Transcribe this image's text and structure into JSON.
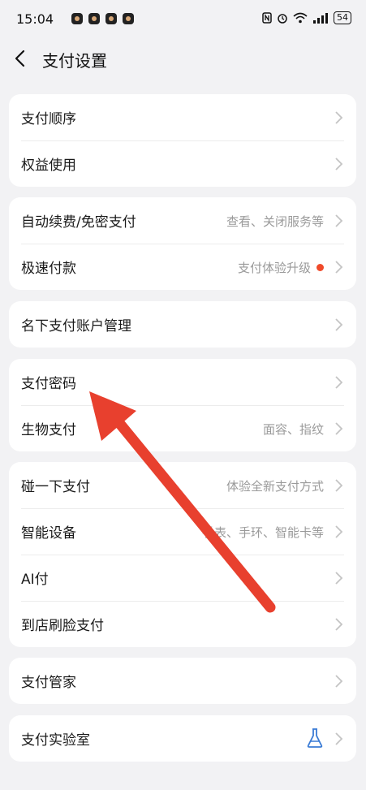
{
  "status_bar": {
    "time": "15:04",
    "signal": "all",
    "battery": "54"
  },
  "header": {
    "title": "支付设置",
    "back_icon": "chevron-left-icon"
  },
  "groups": [
    {
      "items": [
        {
          "label": "支付顺序",
          "hint": ""
        },
        {
          "label": "权益使用",
          "hint": ""
        }
      ]
    },
    {
      "items": [
        {
          "label": "自动续费/免密支付",
          "hint": "查看、关闭服务等"
        },
        {
          "label": "极速付款",
          "hint": "支付体验升级",
          "badge": "red-dot"
        }
      ]
    },
    {
      "items": [
        {
          "label": "名下支付账户管理",
          "hint": ""
        }
      ]
    },
    {
      "items": [
        {
          "label": "支付密码",
          "hint": ""
        },
        {
          "label": "生物支付",
          "hint": "面容、指纹"
        }
      ]
    },
    {
      "items": [
        {
          "label": "碰一下支付",
          "hint": "体验全新支付方式"
        },
        {
          "label": "智能设备",
          "hint": "手表、手环、智能卡等"
        },
        {
          "label": "AI付",
          "hint": ""
        },
        {
          "label": "到店刷脸支付",
          "hint": ""
        }
      ]
    },
    {
      "items": [
        {
          "label": "支付管家",
          "hint": ""
        }
      ]
    },
    {
      "items": [
        {
          "label": "支付实验室",
          "hint": "",
          "icon": "flask-icon"
        }
      ]
    }
  ],
  "colors": {
    "background": "#f2f2f4",
    "card": "#ffffff",
    "badge": "#f04a2a",
    "annotation_arrow": "#e8402e",
    "flask_icon": "#3a7bd5"
  },
  "annotation": {
    "type": "arrow",
    "points_to": "支付密码"
  }
}
